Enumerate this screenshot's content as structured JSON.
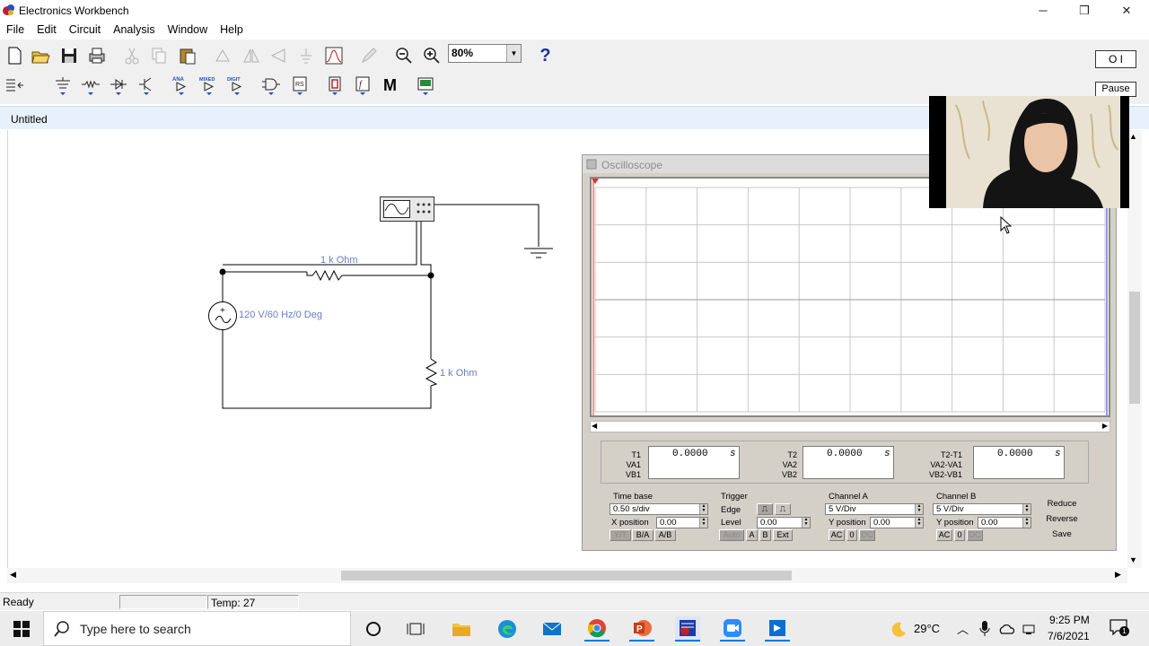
{
  "window": {
    "title": "Electronics Workbench",
    "controls": {
      "minimize": "─",
      "maximize": "❐",
      "close": "✕"
    }
  },
  "menu": [
    "File",
    "Edit",
    "Circuit",
    "Analysis",
    "Window",
    "Help"
  ],
  "toolbar": {
    "zoom_value": "80%",
    "help_label": "?",
    "power_switch": "O I",
    "pause_label": "Pause",
    "parts_bins": [
      "ANA",
      "MIXED",
      "DIGIT"
    ],
    "meter_label": "M"
  },
  "document": {
    "title": "Untitled"
  },
  "circuit": {
    "source_label": "120 V/60 Hz/0 Deg",
    "resistor1_label": "1 k Ohm",
    "resistor2_label": "1 k Ohm"
  },
  "oscilloscope": {
    "title": "Oscilloscope",
    "readouts": [
      {
        "labels": [
          "T1",
          "VA1",
          "VB1"
        ],
        "value": "0.0000",
        "unit": "s"
      },
      {
        "labels": [
          "T2",
          "VA2",
          "VB2"
        ],
        "value": "0.0000",
        "unit": "s"
      },
      {
        "labels": [
          "T2-T1",
          "VA2-VA1",
          "VB2-VB1"
        ],
        "value": "0.0000",
        "unit": "s"
      }
    ],
    "timebase": {
      "label": "Time base",
      "value": "0.50 s/div",
      "xpos_label": "X position",
      "xpos_value": "0.00",
      "modes": [
        "Y/T",
        "B/A",
        "A/B"
      ]
    },
    "trigger": {
      "label": "Trigger",
      "edge_label": "Edge",
      "level_label": "Level",
      "level_value": "0.00",
      "modes": [
        "Auto",
        "A",
        "B",
        "Ext"
      ]
    },
    "channel_a": {
      "label": "Channel A",
      "value": "5 V/Div",
      "ypos_label": "Y position",
      "ypos_value": "0.00",
      "coupling": [
        "AC",
        "0",
        "DC"
      ]
    },
    "channel_b": {
      "label": "Channel B",
      "value": "5 V/Div",
      "ypos_label": "Y position",
      "ypos_value": "0.00",
      "coupling": [
        "AC",
        "0",
        "DC"
      ]
    },
    "buttons": [
      "Reduce",
      "Reverse",
      "Save"
    ]
  },
  "status": {
    "state": "Ready",
    "empty": "",
    "temp": "Temp: 27"
  },
  "taskbar": {
    "search_placeholder": "Type here to search",
    "weather": "29°C",
    "time": "9:25 PM",
    "date": "7/6/2021",
    "notifications": "1"
  },
  "colors": {
    "accent": "#0078d7",
    "trace_red": "#e03030",
    "trace_blue": "#2030d0",
    "wire_label": "#6a7dc0"
  }
}
